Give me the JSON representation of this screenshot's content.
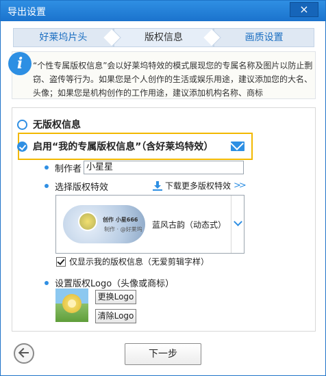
{
  "window": {
    "title": "导出设置"
  },
  "title_bar": {
    "close_icon": "×"
  },
  "steps": [
    {
      "label": "好莱坞片头",
      "state": "done"
    },
    {
      "label": "版权信息",
      "state": "active"
    },
    {
      "label": "画质设置",
      "state": "pending"
    }
  ],
  "info": {
    "icon": "i",
    "text": "“个性专属版权信息”会以好莱坞特效的模式展现您的专属名称及图片以防止剽窃、盗传等行为。如果您是个人创作的生活或娱乐用途，建议添加您的大名、头像；如果您是机构创作的工作用途，建议添加机构名称、商标"
  },
  "options": {
    "no_copyright_label": "无版权信息",
    "enable_copyright_label": "启用“我的专属版权信息”（含好莱坞特效）",
    "selected": "enable"
  },
  "author": {
    "label": "制作者",
    "value": "小星星"
  },
  "effect": {
    "label": "选择版权特效",
    "download_link": "下载更多版权特效",
    "selected_style": "蓝风古韵（动态式）",
    "preview_line1": "创作 小星666",
    "preview_line2": "制作 · @好莱坞"
  },
  "only_mine": {
    "label": "仅显示我的版权信息（无爱剪辑字样）",
    "checked": true
  },
  "logo": {
    "label": "设置版权Logo（头像或商标）",
    "change_button": "更换Logo",
    "clear_button": "清除Logo"
  },
  "footer": {
    "next_button": "下一步"
  },
  "colors": {
    "accent": "#2f8fe3",
    "highlight": "#f2b800",
    "titlebar": "#1b73cd"
  }
}
